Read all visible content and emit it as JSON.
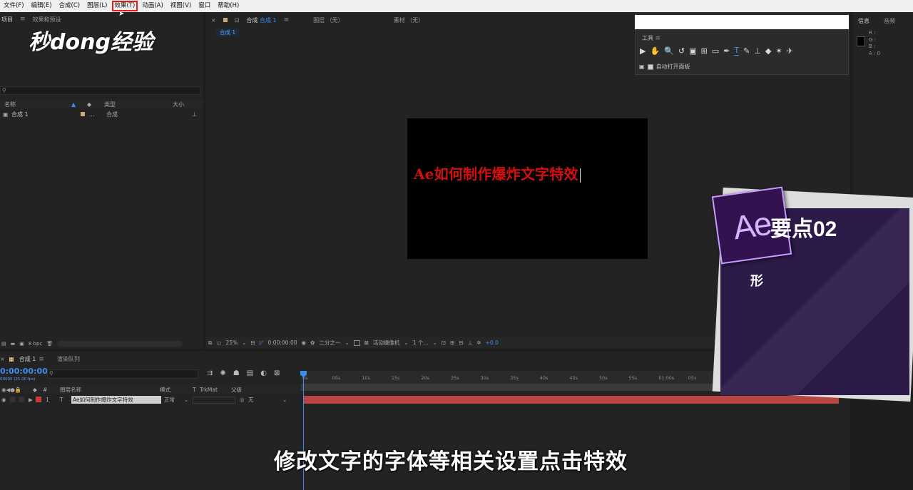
{
  "menu": [
    "文件(F)",
    "编辑(E)",
    "合成(C)",
    "图层(L)",
    "效果(T)",
    "动画(A)",
    "视图(V)",
    "窗口",
    "帮助(H)"
  ],
  "menu_highlight_index": 4,
  "project": {
    "tab_project": "项目",
    "tab_effects": "效果和预设",
    "logo": "秒dong经验",
    "col_name": "名称",
    "col_type": "类型",
    "col_size": "大小",
    "row_name": "合成 1",
    "row_extra": "...",
    "row_type": "合成",
    "footer_bpc": "8 bpc"
  },
  "comp": {
    "tab_comp": "合成",
    "tab_comp_name": "合成 1",
    "tab_layer": "图层 （无）",
    "tab_footage": "素材 （无）",
    "crumb": "合成 1",
    "viewer_text": "Ae如何制作爆炸文字特效",
    "zoom": "25%",
    "timecode": "0:00:00:00",
    "resolution": "二分之一",
    "camera": "活动摄像机",
    "views": "1 个...",
    "exposure": "+0.0"
  },
  "tools": {
    "title": "工具",
    "icons": [
      "▶",
      "✋",
      "🔍",
      "↺",
      "▣",
      "⊞",
      "▭",
      "✒",
      "T",
      "✎",
      "⊥",
      "◆",
      "✶",
      "✈"
    ],
    "selected_index": 8,
    "auto_open": "自动打开面板"
  },
  "info": {
    "tab_info": "信息",
    "tab_audio": "音频",
    "r": "R :",
    "g": "G :",
    "b": "B :",
    "a": "A : 0"
  },
  "timeline": {
    "tab_comp": "合成 1",
    "tab_render": "渲染队列",
    "time": "0:00:00:00",
    "fps": "00000 (25.00 fps)",
    "col_num": "#",
    "col_layer": "图层名称",
    "col_mode": "模式",
    "col_t": "T",
    "col_trkmat": "TrkMat",
    "col_parent": "父级",
    "layer_index": "1",
    "layer_type": "T",
    "layer_name": "Ae如何制作爆炸文字特效",
    "layer_mode": "正常",
    "layer_parent": "无",
    "ruler": [
      "0s",
      "05s",
      "10s",
      "15s",
      "20s",
      "25s",
      "30s",
      "35s",
      "40s",
      "45s",
      "50s",
      "55s",
      "01:00s",
      "05s"
    ]
  },
  "card": {
    "logo": "Ae",
    "title": "要点02",
    "sub": "形"
  },
  "subtitle": "修改文字的字体等相关设置点击特效",
  "colors": {
    "accent": "#3b8ef0",
    "viewer_text": "#d40f0f",
    "layer_bar": "#b84444",
    "card_bg": "#2c1a48"
  }
}
